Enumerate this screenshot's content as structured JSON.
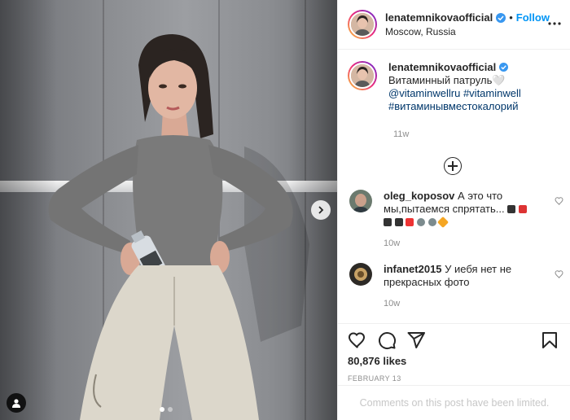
{
  "post": {
    "username": "lenatemnikovaofficial",
    "follow_label": "Follow",
    "location": "Moscow, Russia",
    "caption": {
      "username": "lenatemnikovaofficial",
      "text": "Витаминный патруль🤍",
      "mention": "@vitaminwellru",
      "hashtag1": "#vitaminwell",
      "hashtag2": "#витаминывместокалорий",
      "time": "11w"
    },
    "comments": [
      {
        "username": "oleg_koposov",
        "text": "А это что мы,пытаемся спрятать...",
        "time": "10w"
      },
      {
        "username": "infanet2015",
        "text": "У иебя нет не прекрасных фото",
        "time": "10w"
      }
    ],
    "likes": "80,876 likes",
    "date": "FEBRUARY 13",
    "comments_limited": "Comments on this post have been limited."
  },
  "carousel": {
    "slides": 2,
    "active": 0
  },
  "colors": {
    "follow": "#0095f6",
    "link": "#00376b",
    "verified": "#3897f0",
    "muted": "#8e8e8e"
  },
  "icons": {
    "verified": "verified-badge-icon",
    "more": "more-options-icon",
    "load_more": "plus-circle-icon",
    "heart": "heart-icon",
    "comment": "comment-icon",
    "share": "paper-plane-icon",
    "save": "bookmark-icon",
    "next": "chevron-right-icon",
    "tag": "user-tag-icon"
  }
}
